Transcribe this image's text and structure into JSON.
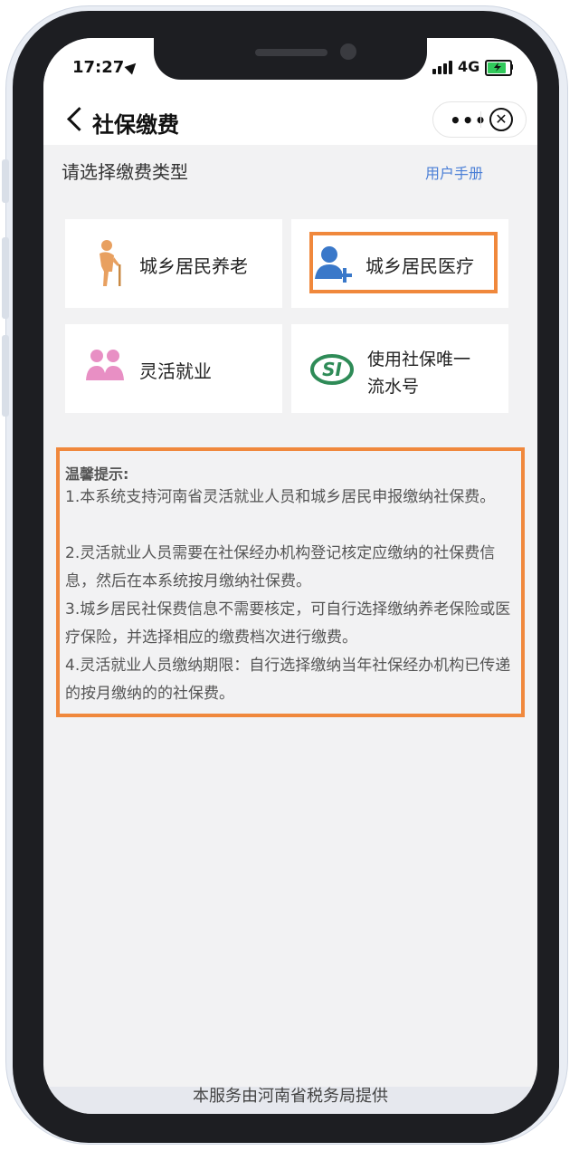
{
  "status_bar": {
    "time": "17:27",
    "network": "4G"
  },
  "nav": {
    "title": "社保缴费",
    "more_label": "•••",
    "close_label": "✕"
  },
  "section": {
    "heading": "请选择缴费类型",
    "manual_link": "用户手册"
  },
  "cards": [
    {
      "label": "城乡居民养老",
      "icon": "elderly-person-icon"
    },
    {
      "label": "城乡居民医疗",
      "icon": "add-person-icon",
      "highlighted": true
    },
    {
      "label": "灵活就业",
      "icon": "people-group-icon"
    },
    {
      "label_line1": "使用社保唯一",
      "label_line2": "流水号",
      "icon": "si-logo-icon"
    }
  ],
  "tips": {
    "title": "温馨提示:",
    "items": [
      "1.本系统支持河南省灵活就业人员和城乡居民申报缴纳社保费。",
      "2.灵活就业人员需要在社保经办机构登记核定应缴纳的社保费信息，然后在本系统按月缴纳社保费。",
      "3.城乡居民社保费信息不需要核定，可自行选择缴纳养老保险或医疗保险，并选择相应的缴费档次进行缴费。",
      "4.灵活就业人员缴纳期限：自行选择缴纳当年社保经办机构已传递的按月缴纳的的社保费。"
    ]
  },
  "footer": {
    "text": "本服务由河南省税务局提供"
  },
  "colors": {
    "highlight": "#f0883c",
    "link": "#4b7fd6",
    "battery": "#31c95b",
    "pink_icon": "#e88fc4",
    "green_icon": "#2e8b57",
    "blue_icon": "#3a78c9",
    "orange_icon": "#e8a060"
  }
}
